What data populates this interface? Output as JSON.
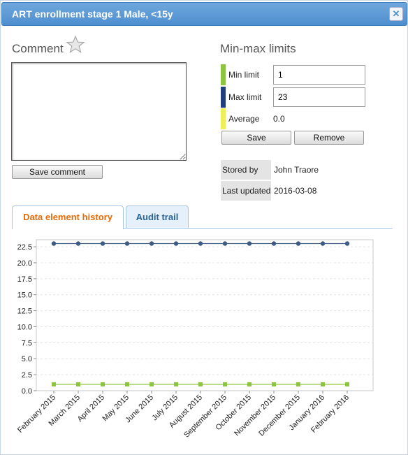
{
  "window": {
    "title": "ART enrollment stage 1 Male, <15y",
    "close_glyph": "✕"
  },
  "comment": {
    "heading": "Comment",
    "value": "",
    "save_label": "Save comment"
  },
  "limits": {
    "heading": "Min-max limits",
    "min_label": "Min limit",
    "min_value": "1",
    "max_label": "Max limit",
    "max_value": "23",
    "avg_label": "Average",
    "avg_value": "0.0",
    "save_label": "Save",
    "remove_label": "Remove",
    "colors": {
      "min": "#8cc43f",
      "max": "#233e7a",
      "avg": "#eef05a"
    }
  },
  "meta": {
    "stored_by_label": "Stored by",
    "stored_by_value": "John Traore",
    "last_updated_label": "Last updated",
    "last_updated_value": "2016-03-08"
  },
  "tabs": [
    {
      "label": "Data element history",
      "active": true
    },
    {
      "label": "Audit trail",
      "active": false
    }
  ],
  "chart_data": {
    "type": "line",
    "categories": [
      "February 2015",
      "March 2015",
      "April 2015",
      "May 2015",
      "June 2015",
      "July 2015",
      "August 2015",
      "September 2015",
      "October 2015",
      "November 2015",
      "December 2015",
      "January 2016",
      "February 2016"
    ],
    "series": [
      {
        "values": [
          23,
          23,
          23,
          23,
          23,
          23,
          23,
          23,
          23,
          23,
          23,
          23,
          23
        ],
        "color": "#3d5a80",
        "marker": "circle"
      },
      {
        "values": [
          1,
          1,
          1,
          1,
          1,
          1,
          1,
          1,
          1,
          1,
          1,
          1,
          1
        ],
        "color": "#8cc43f",
        "marker": "square"
      }
    ],
    "ylim": [
      0,
      23.6
    ],
    "yticks": [
      "0.0",
      "2.5",
      "5.0",
      "7.5",
      "10.0",
      "12.5",
      "15.0",
      "17.5",
      "20.0",
      "22.5"
    ],
    "grid": true,
    "title": "",
    "xlabel": "",
    "ylabel": ""
  }
}
